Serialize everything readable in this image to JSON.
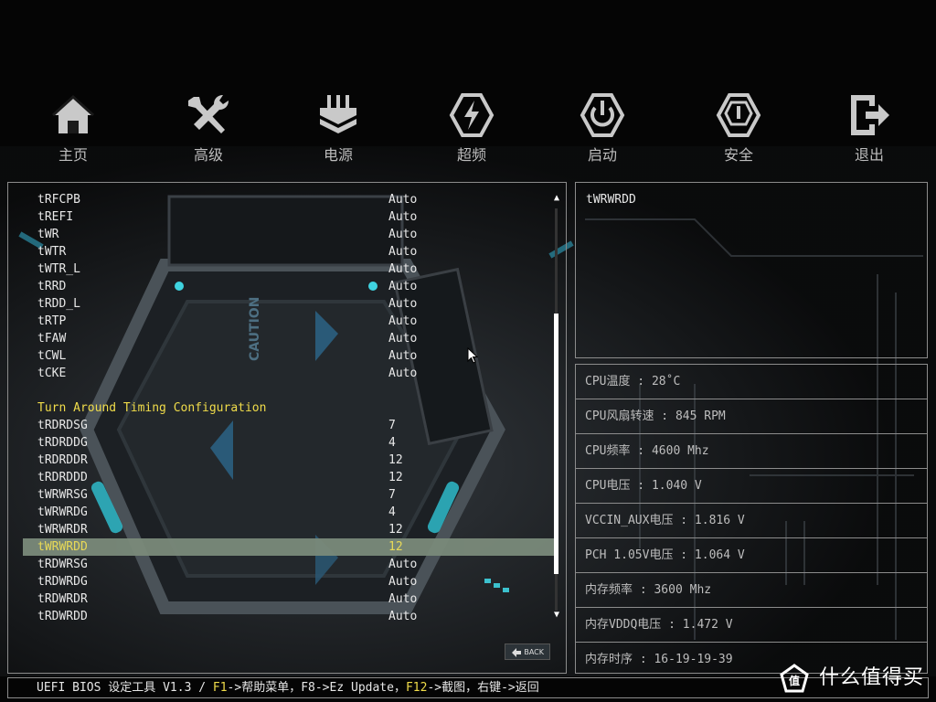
{
  "nav": {
    "items": [
      {
        "label": "主页",
        "icon": "home-icon"
      },
      {
        "label": "高级",
        "icon": "tools-icon"
      },
      {
        "label": "电源",
        "icon": "power-plug-icon"
      },
      {
        "label": "超频",
        "icon": "overclock-icon"
      },
      {
        "label": "启动",
        "icon": "power-icon"
      },
      {
        "label": "安全",
        "icon": "shield-icon"
      },
      {
        "label": "退出",
        "icon": "exit-icon"
      }
    ]
  },
  "settings": {
    "rows": [
      {
        "label": "tRFCPB",
        "value": "Auto"
      },
      {
        "label": "tREFI",
        "value": "Auto"
      },
      {
        "label": "tWR",
        "value": "Auto"
      },
      {
        "label": "tWTR",
        "value": "Auto"
      },
      {
        "label": "tWTR_L",
        "value": "Auto"
      },
      {
        "label": "tRRD",
        "value": "Auto"
      },
      {
        "label": "tRDD_L",
        "value": "Auto"
      },
      {
        "label": "tRTP",
        "value": "Auto"
      },
      {
        "label": "tFAW",
        "value": "Auto"
      },
      {
        "label": "tCWL",
        "value": "Auto"
      },
      {
        "label": "tCKE",
        "value": "Auto"
      },
      {
        "label": "",
        "value": ""
      },
      {
        "label": "Turn Around Timing Configuration",
        "value": "",
        "section": true
      },
      {
        "label": "tRDRDSG",
        "value": "7"
      },
      {
        "label": "tRDRDDG",
        "value": "4"
      },
      {
        "label": "tRDRDDR",
        "value": "12"
      },
      {
        "label": "tRDRDDD",
        "value": "12"
      },
      {
        "label": "tWRWRSG",
        "value": "7"
      },
      {
        "label": "tWRWRDG",
        "value": "4"
      },
      {
        "label": "tWRWRDR",
        "value": "12"
      },
      {
        "label": "tWRWRDD",
        "value": "12",
        "selected": true
      },
      {
        "label": "tRDWRSG",
        "value": "Auto"
      },
      {
        "label": "tRDWRDG",
        "value": "Auto"
      },
      {
        "label": "tRDWRDR",
        "value": "Auto"
      },
      {
        "label": "tRDWRDD",
        "value": "Auto"
      }
    ],
    "back_label": "BACK",
    "scroll_position": 0.22
  },
  "help": {
    "text": "tWRWRDD"
  },
  "info": {
    "rows": [
      "CPU温度 : 28˚C",
      "CPU风扇转速 : 845 RPM",
      "CPU频率 : 4600 Mhz",
      "CPU电压 : 1.040 V",
      "VCCIN_AUX电压 : 1.816 V",
      "PCH 1.05V电压 : 1.064 V",
      "内存频率 : 3600 Mhz",
      "内存VDDQ电压 : 1.472 V",
      "内存时序 : 16-19-19-39"
    ]
  },
  "footer": {
    "part1": "UEFI BIOS 设定工具 V1.3 / ",
    "f1": "F1",
    "part2": "->帮助菜单，F8->Ez Update，",
    "f12": "F12",
    "part3": "->截图，右键->返回"
  },
  "watermark": {
    "text": "什么值得买"
  },
  "colors": {
    "accent": "#f0dc4a",
    "selected_bg": "#7a8a7a",
    "border": "#8c8c8c",
    "glow": "#3fd3e0"
  }
}
